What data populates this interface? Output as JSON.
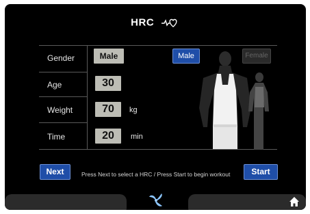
{
  "header": {
    "title": "HRC",
    "icon": "heart-rate-icon"
  },
  "form": {
    "gender": {
      "label": "Gender",
      "value": "Male",
      "options": [
        {
          "label": "Male",
          "selected": true
        },
        {
          "label": "Female",
          "selected": false
        }
      ]
    },
    "age": {
      "label": "Age",
      "value": "30"
    },
    "weight": {
      "label": "Weight",
      "value": "70",
      "unit": "kg"
    },
    "time": {
      "label": "Time",
      "value": "20",
      "unit": "min"
    }
  },
  "actions": {
    "next_label": "Next",
    "start_label": "Start",
    "instruction": "Press Next to select a HRC  /  Press Start to begin workout"
  },
  "footer": {
    "center_icon": "fan-icon",
    "home_icon": "home-icon"
  },
  "colors": {
    "screen_bg": "#000000",
    "accent_blue": "#1f4ea8",
    "value_box": "#bdbdb5",
    "divider": "#5a5a5a"
  }
}
